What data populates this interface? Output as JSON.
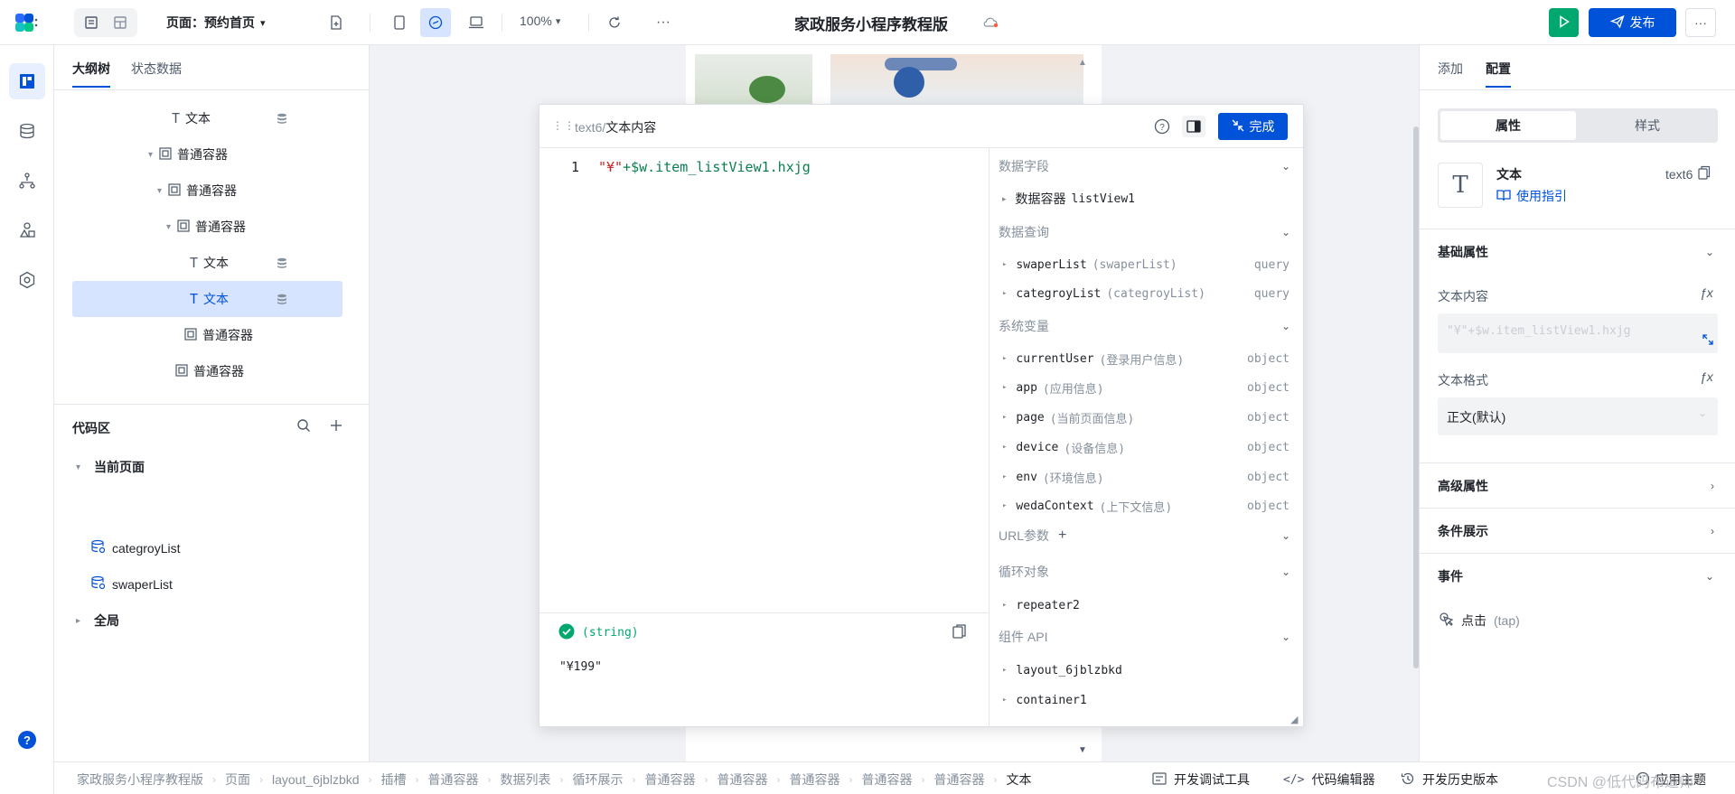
{
  "topbar": {
    "page_selector": "页面：预约首页",
    "zoom": "100%",
    "app_title": "家政服务小程序教程版",
    "publish_label": "发布",
    "more": "···"
  },
  "left": {
    "tabs": [
      "大纲树",
      "状态数据"
    ],
    "tree": [
      {
        "label": "文本",
        "type": "text",
        "has_db": true
      },
      {
        "label": "普通容器",
        "type": "container",
        "caret": "▾"
      },
      {
        "label": "普通容器",
        "type": "container",
        "caret": "▾"
      },
      {
        "label": "普通容器",
        "type": "container",
        "caret": "▾"
      },
      {
        "label": "文本",
        "type": "text",
        "has_db": true
      },
      {
        "label": "文本",
        "type": "text",
        "has_db": true,
        "selected": true
      },
      {
        "label": "普通容器",
        "type": "container"
      },
      {
        "label": "普通容器",
        "type": "container"
      }
    ],
    "code_area": {
      "title": "代码区",
      "current_page": "当前页面",
      "items": [
        "categroyList",
        "swaperList"
      ],
      "global": "全局"
    }
  },
  "editor": {
    "crumb_prefix": "text6",
    "crumb_sep": "/",
    "crumb_title": "文本内容",
    "done_label": "完成",
    "line_no": "1",
    "code_str": "\"¥\"",
    "code_rest": "+$w.item_listView1.hxjg",
    "result_type": "(string)",
    "result_value": "\"¥199\"",
    "vars": {
      "data_fields": "数据字段",
      "data_container": "数据容器",
      "data_container_name": "listView1",
      "data_query": "数据查询",
      "queries": [
        {
          "name": "swaperList",
          "sub": "(swaperList)",
          "type": "query"
        },
        {
          "name": "categroyList",
          "sub": "(categroyList)",
          "type": "query"
        }
      ],
      "system_vars": "系统变量",
      "sys": [
        {
          "name": "currentUser",
          "sub": "(登录用户信息)",
          "type": "object"
        },
        {
          "name": "app",
          "sub": "(应用信息)",
          "type": "object"
        },
        {
          "name": "page",
          "sub": "(当前页面信息)",
          "type": "object"
        },
        {
          "name": "device",
          "sub": "(设备信息)",
          "type": "object"
        },
        {
          "name": "env",
          "sub": "(环境信息)",
          "type": "object"
        },
        {
          "name": "wedaContext",
          "sub": "(上下文信息)",
          "type": "object"
        }
      ],
      "url_params": "URL参数",
      "loop_objects": "循环对象",
      "loop_item": "repeater2",
      "component_api": "组件 API",
      "components": [
        "layout_6jblzbkd",
        "container1"
      ]
    }
  },
  "right": {
    "tabs": [
      "添加",
      "配置"
    ],
    "seg": [
      "属性",
      "样式"
    ],
    "component_name": "文本",
    "component_id": "text6",
    "guide_link": "使用指引",
    "basic_props": "基础属性",
    "text_content_label": "文本内容",
    "text_content_value": "\"¥\"+$w.item_listView1.hxjg",
    "text_format_label": "文本格式",
    "text_format_value": "正文(默认)",
    "advanced": "高级属性",
    "conditional": "条件展示",
    "events": "事件",
    "event_item": "点击",
    "event_item_sub": "(tap)"
  },
  "bottom": {
    "crumbs": [
      "家政服务小程序教程版",
      "页面",
      "layout_6jblzbkd",
      "插槽",
      "普通容器",
      "数据列表",
      "循环展示",
      "普通容器",
      "普通容器",
      "普通容器",
      "普通容器",
      "普通容器",
      "文本"
    ],
    "tools": [
      "开发调试工具",
      "代码编辑器",
      "开发历史版本"
    ],
    "watermark": "CSDN @低代码布道师",
    "app_theme": "应用主题"
  },
  "colors": {
    "accent": "#0052d9",
    "run": "#00a870",
    "string": "#c62828",
    "code": "#0a7f4f"
  }
}
